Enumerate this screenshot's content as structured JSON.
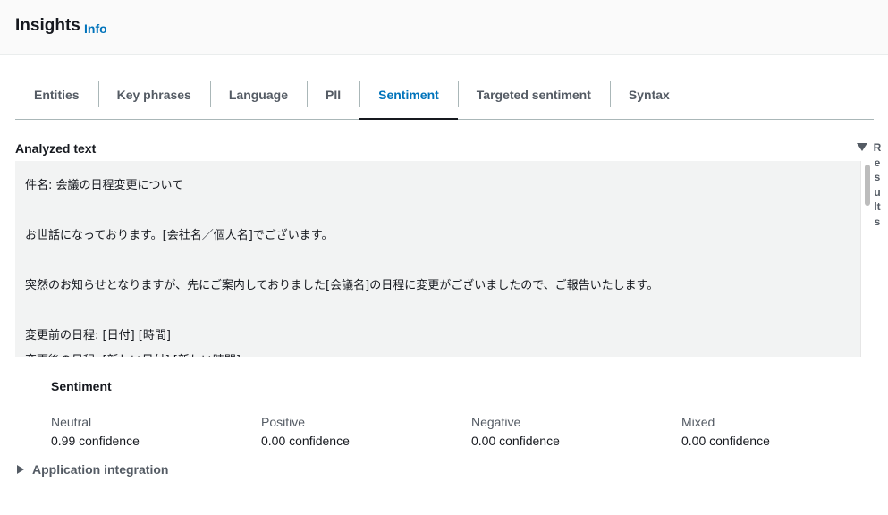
{
  "header": {
    "title": "Insights",
    "info_link": "Info"
  },
  "tabs": [
    {
      "label": "Entities",
      "active": false
    },
    {
      "label": "Key phrases",
      "active": false
    },
    {
      "label": "Language",
      "active": false
    },
    {
      "label": "PII",
      "active": false
    },
    {
      "label": "Sentiment",
      "active": true
    },
    {
      "label": "Targeted sentiment",
      "active": false
    },
    {
      "label": "Syntax",
      "active": false
    }
  ],
  "analyzed_text": {
    "title": "Analyzed text",
    "lines": [
      "件名: 会議の日程変更について",
      "",
      "お世話になっております。[会社名／個人名]でございます。",
      "",
      "突然のお知らせとなりますが、先にご案内しておりました[会議名]の日程に変更がございましたので、ご報告いたします。",
      "",
      "変更前の日程: [日付] [時間]",
      "変更後の日程: [新しい日付] [新しい時間]"
    ]
  },
  "results_panel": {
    "label": "Results"
  },
  "sentiment": {
    "title": "Sentiment",
    "metrics": [
      {
        "label": "Neutral",
        "value": "0.99 confidence"
      },
      {
        "label": "Positive",
        "value": "0.00 confidence"
      },
      {
        "label": "Negative",
        "value": "0.00 confidence"
      },
      {
        "label": "Mixed",
        "value": "0.00 confidence"
      }
    ]
  },
  "application_integration": {
    "label": "Application integration"
  },
  "colors": {
    "accent": "#0073bb",
    "text": "#16191f",
    "muted": "#545b64",
    "panel": "#f2f3f3"
  }
}
